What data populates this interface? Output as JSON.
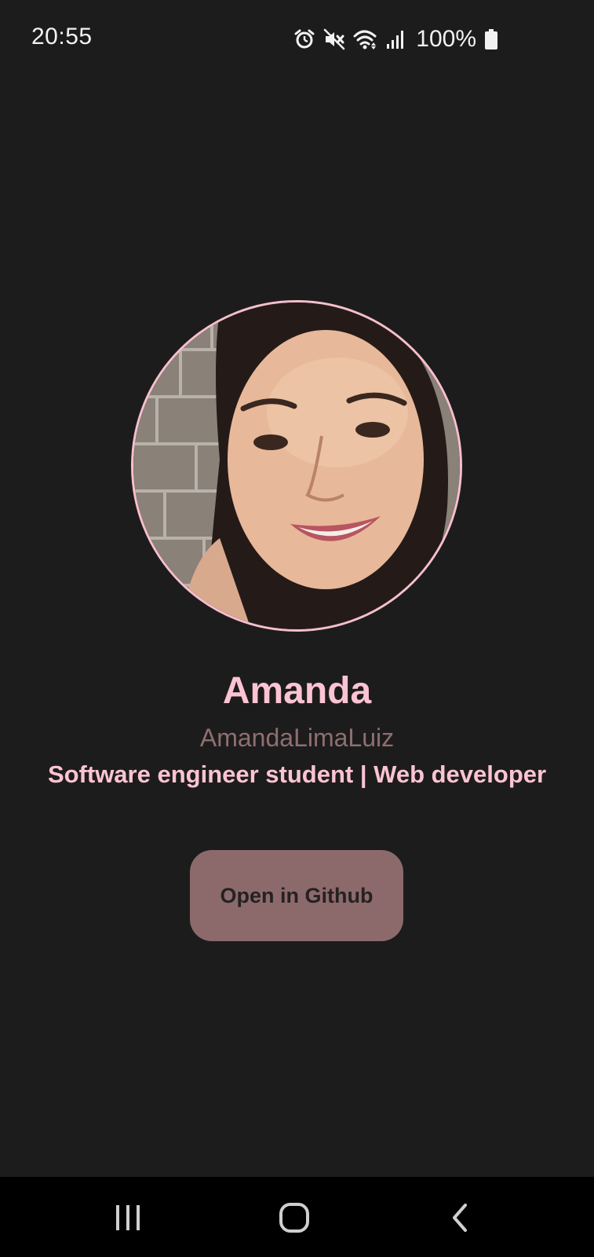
{
  "status_bar": {
    "time": "20:55",
    "battery_percent": "100%",
    "icons": [
      "alarm-icon",
      "mute-icon",
      "wifi-icon",
      "signal-icon",
      "battery-icon"
    ]
  },
  "profile": {
    "name": "Amanda",
    "username": "AmandaLimaLuiz",
    "bio": "Software engineer student | Web developer",
    "avatar": "profile-photo"
  },
  "actions": {
    "open_github_label": "Open in Github"
  },
  "nav_bar": {
    "icons": [
      "recent-apps-icon",
      "home-icon",
      "back-icon"
    ]
  },
  "colors": {
    "background": "#1d1c1d",
    "accent_pink": "#fcc4d3",
    "muted_username": "#8e6f6f",
    "button_bg": "#8c6a6b",
    "avatar_border": "#f7bfcd"
  }
}
